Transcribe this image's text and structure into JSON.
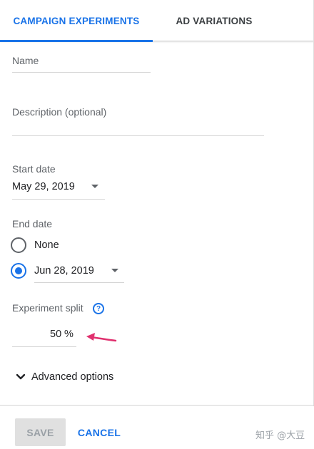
{
  "tabs": [
    {
      "label": "CAMPAIGN EXPERIMENTS",
      "active": true
    },
    {
      "label": "AD VARIATIONS",
      "active": false
    }
  ],
  "form": {
    "name_placeholder": "Name",
    "description_placeholder": "Description (optional)",
    "start_date": {
      "label": "Start date",
      "value": "May 29, 2019"
    },
    "end_date": {
      "label": "End date",
      "options": [
        {
          "label": "None",
          "selected": false
        },
        {
          "value": "Jun 28, 2019",
          "selected": true
        }
      ]
    },
    "experiment_split": {
      "label": "Experiment split",
      "value": "50",
      "unit": "%",
      "help_icon": "help-icon"
    },
    "advanced_options_label": "Advanced options"
  },
  "footer": {
    "save_label": "SAVE",
    "cancel_label": "CANCEL",
    "save_disabled": true
  },
  "watermark": "知乎 @大豆",
  "annotation": {
    "arrow_color": "#e0306e"
  },
  "colors": {
    "accent": "#1a73e8",
    "text": "#202124",
    "muted": "#5f6368"
  }
}
